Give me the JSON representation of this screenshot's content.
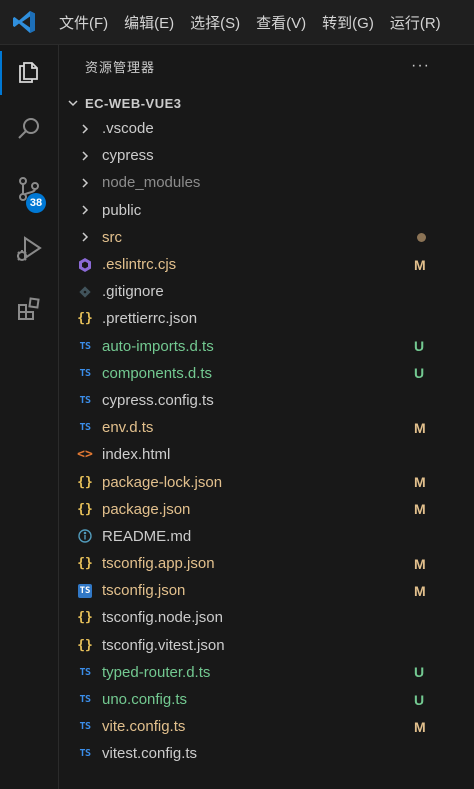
{
  "colors": {
    "accent": "#0078d4",
    "modified": "#e2c08d",
    "untracked": "#73c991",
    "default_text": "#cccccc",
    "ignored": "#8c8c8c"
  },
  "menu": [
    "文件(F)",
    "编辑(E)",
    "选择(S)",
    "查看(V)",
    "转到(G)",
    "运行(R)"
  ],
  "activity": {
    "source_control_badge": "38"
  },
  "sidebar": {
    "title": "资源管理器",
    "more": "···",
    "project": "EC-WEB-VUE3"
  },
  "tree": [
    {
      "name": ".vscode",
      "type": "folder",
      "icon": "chevron-right-icon",
      "color": "#cccccc",
      "status": ""
    },
    {
      "name": "cypress",
      "type": "folder",
      "icon": "chevron-right-icon",
      "color": "#cccccc",
      "status": ""
    },
    {
      "name": "node_modules",
      "type": "folder",
      "icon": "chevron-right-icon",
      "color": "#8c8c8c",
      "status": ""
    },
    {
      "name": "public",
      "type": "folder",
      "icon": "chevron-right-icon",
      "color": "#cccccc",
      "status": ""
    },
    {
      "name": "src",
      "type": "folder",
      "icon": "chevron-right-icon",
      "color": "#e2c08d",
      "status": "dot"
    },
    {
      "name": ".eslintrc.cjs",
      "type": "file",
      "icon": "eslint-icon",
      "color": "#e2c08d",
      "status": "M"
    },
    {
      "name": ".gitignore",
      "type": "file",
      "icon": "git-icon",
      "color": "#cccccc",
      "status": ""
    },
    {
      "name": ".prettierrc.json",
      "type": "file",
      "icon": "json-icon",
      "color": "#cccccc",
      "status": ""
    },
    {
      "name": "auto-imports.d.ts",
      "type": "file",
      "icon": "ts-icon",
      "color": "#73c991",
      "status": "U"
    },
    {
      "name": "components.d.ts",
      "type": "file",
      "icon": "ts-icon",
      "color": "#73c991",
      "status": "U"
    },
    {
      "name": "cypress.config.ts",
      "type": "file",
      "icon": "ts-icon",
      "color": "#cccccc",
      "status": ""
    },
    {
      "name": "env.d.ts",
      "type": "file",
      "icon": "ts-icon",
      "color": "#e2c08d",
      "status": "M"
    },
    {
      "name": "index.html",
      "type": "file",
      "icon": "html-icon",
      "color": "#cccccc",
      "status": ""
    },
    {
      "name": "package-lock.json",
      "type": "file",
      "icon": "json-icon",
      "color": "#e2c08d",
      "status": "M"
    },
    {
      "name": "package.json",
      "type": "file",
      "icon": "json-icon",
      "color": "#e2c08d",
      "status": "M"
    },
    {
      "name": "README.md",
      "type": "file",
      "icon": "info-icon",
      "color": "#cccccc",
      "status": ""
    },
    {
      "name": "tsconfig.app.json",
      "type": "file",
      "icon": "json-icon",
      "color": "#e2c08d",
      "status": "M"
    },
    {
      "name": "tsconfig.json",
      "type": "file",
      "icon": "tsconfig-icon",
      "color": "#e2c08d",
      "status": "M"
    },
    {
      "name": "tsconfig.node.json",
      "type": "file",
      "icon": "json-icon",
      "color": "#cccccc",
      "status": ""
    },
    {
      "name": "tsconfig.vitest.json",
      "type": "file",
      "icon": "json-icon",
      "color": "#cccccc",
      "status": ""
    },
    {
      "name": "typed-router.d.ts",
      "type": "file",
      "icon": "ts-icon",
      "color": "#73c991",
      "status": "U"
    },
    {
      "name": "uno.config.ts",
      "type": "file",
      "icon": "ts-icon",
      "color": "#73c991",
      "status": "U"
    },
    {
      "name": "vite.config.ts",
      "type": "file",
      "icon": "ts-icon",
      "color": "#e2c08d",
      "status": "M"
    },
    {
      "name": "vitest.config.ts",
      "type": "file",
      "icon": "ts-icon",
      "color": "#cccccc",
      "status": ""
    }
  ]
}
